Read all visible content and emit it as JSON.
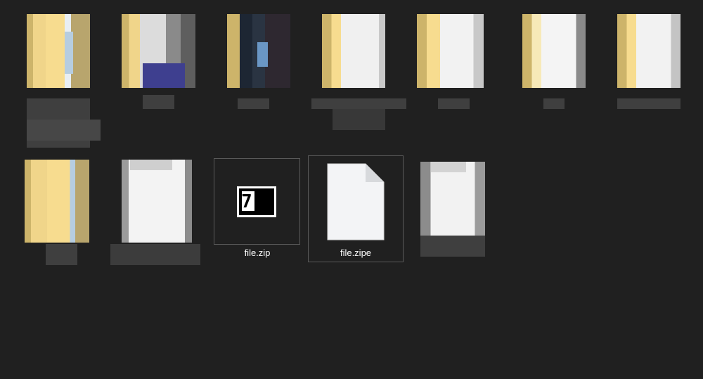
{
  "window": {
    "view_mode": "large-icons",
    "background": "#202020"
  },
  "files": [
    {
      "kind": "folder",
      "name": "",
      "blurred": true
    },
    {
      "kind": "folder",
      "name": "",
      "blurred": true
    },
    {
      "kind": "folder",
      "name": "",
      "blurred": true
    },
    {
      "kind": "folder",
      "name": "",
      "blurred": true
    },
    {
      "kind": "folder",
      "name": "",
      "blurred": true
    },
    {
      "kind": "folder",
      "name": "",
      "blurred": true
    },
    {
      "kind": "folder",
      "name": "",
      "blurred": true
    },
    {
      "kind": "folder",
      "name": "",
      "blurred": true
    },
    {
      "kind": "file",
      "name": "",
      "blurred": true
    },
    {
      "kind": "archive-7z",
      "name": "file.zip",
      "blurred": false,
      "icon": "7z-archive-icon",
      "icon_text": "7z"
    },
    {
      "kind": "file",
      "name": "file.zipe",
      "blurred": false,
      "icon": "blank-file-icon"
    },
    {
      "kind": "file",
      "name": "",
      "blurred": true
    }
  ],
  "colors": {
    "folder_yellow": "#f5d77e",
    "folder_dark": "#b39d5a",
    "file_white": "#f3f4f6",
    "label": "#ffffff",
    "selection_border": "#5a5a5a"
  }
}
